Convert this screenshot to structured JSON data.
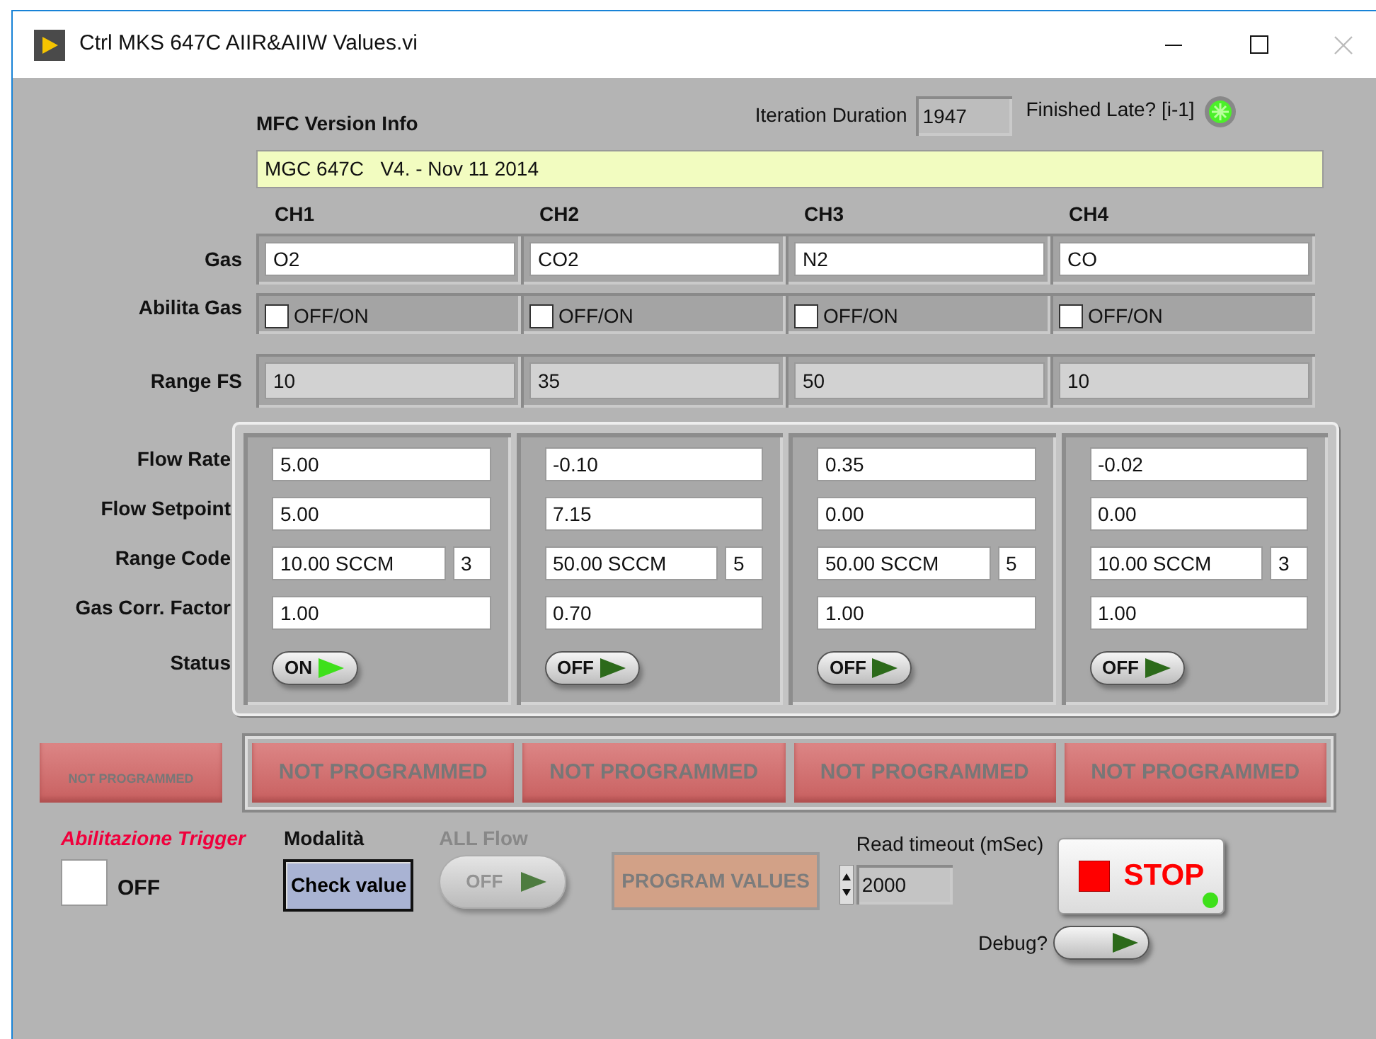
{
  "window": {
    "title": "Ctrl MKS 647C AIIR&AIIW Values.vi"
  },
  "header": {
    "version_label": "MFC Version Info",
    "version_info": "MGC 647C   V4. - Nov 11 2014",
    "iteration_label": "Iteration Duration",
    "iteration_value": "1947",
    "finished_late_label": "Finished Late? [i-1]",
    "finished_late_on": true
  },
  "row_labels": {
    "gas": "Gas",
    "enable": "Abilita Gas",
    "range_fs": "Range FS",
    "flow_rate": "Flow Rate",
    "flow_setpoint": "Flow Setpoint",
    "range_code": "Range Code",
    "corr_factor": "Gas Corr. Factor",
    "status": "Status"
  },
  "channels": [
    {
      "name": "CH1",
      "gas": "O2",
      "enable_label": "OFF/ON",
      "enabled": false,
      "range_fs": "10",
      "flow_rate": "5.00",
      "flow_setpoint": "5.00",
      "range": "10.00 SCCM",
      "range_code": "3",
      "corr_factor": "1.00",
      "status_text": "ON",
      "status_on": true,
      "program_state": "NOT PROGRAMMED"
    },
    {
      "name": "CH2",
      "gas": "CO2",
      "enable_label": "OFF/ON",
      "enabled": false,
      "range_fs": "35",
      "flow_rate": "-0.10",
      "flow_setpoint": "7.15",
      "range": "50.00 SCCM",
      "range_code": "5",
      "corr_factor": "0.70",
      "status_text": "OFF",
      "status_on": false,
      "program_state": "NOT PROGRAMMED"
    },
    {
      "name": "CH3",
      "gas": "N2",
      "enable_label": "OFF/ON",
      "enabled": false,
      "range_fs": "50",
      "flow_rate": "0.35",
      "flow_setpoint": "0.00",
      "range": "50.00 SCCM",
      "range_code": "5",
      "corr_factor": "1.00",
      "status_text": "OFF",
      "status_on": false,
      "program_state": "NOT PROGRAMMED"
    },
    {
      "name": "CH4",
      "gas": "CO",
      "enable_label": "OFF/ON",
      "enabled": false,
      "range_fs": "10",
      "flow_rate": "-0.02",
      "flow_setpoint": "0.00",
      "range": "10.00 SCCM",
      "range_code": "3",
      "corr_factor": "1.00",
      "status_text": "OFF",
      "status_on": false,
      "program_state": "NOT PROGRAMMED"
    }
  ],
  "program_summary": "NOT PROGRAMMED",
  "trigger": {
    "label": "Abilitazione Trigger",
    "checked": false,
    "state_text": "OFF"
  },
  "mode": {
    "label": "Modalità",
    "button": "Check value"
  },
  "all_flow": {
    "label": "ALL Flow",
    "text": "OFF",
    "on": false,
    "disabled": true
  },
  "program_button": {
    "label": "PROGRAM VALUES",
    "disabled": true
  },
  "timeout": {
    "label": "Read timeout (mSec)",
    "value": "2000"
  },
  "stop": {
    "label": "STOP",
    "lit": true
  },
  "debug": {
    "label": "Debug?",
    "on": false
  }
}
